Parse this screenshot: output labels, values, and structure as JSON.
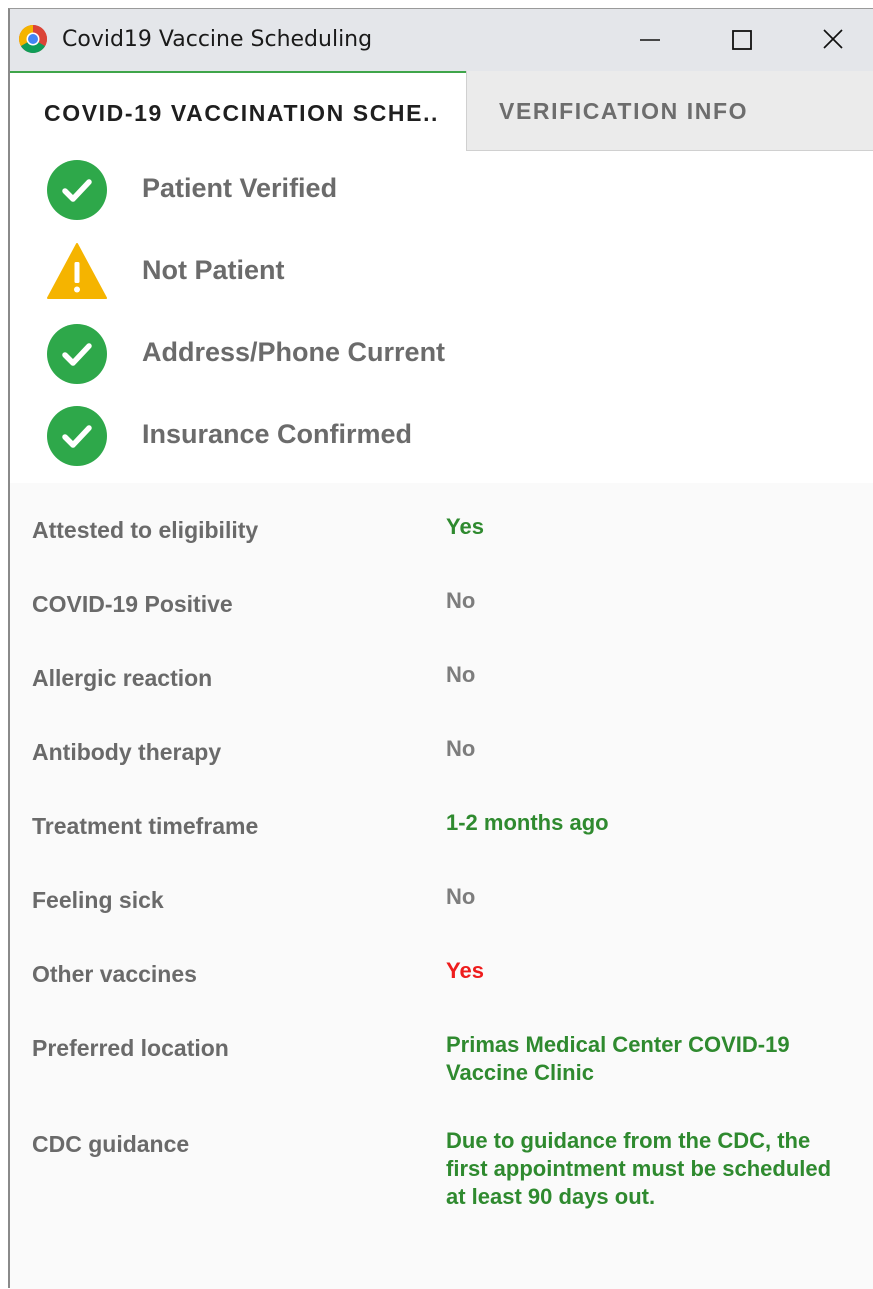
{
  "window": {
    "title": "Covid19 Vaccine Scheduling",
    "app_icon": "chrome-icon"
  },
  "tabs": [
    {
      "label": "COVID-19 VACCINATION SCHE..",
      "active": true
    },
    {
      "label": "VERIFICATION INFO",
      "active": false
    }
  ],
  "status_items": [
    {
      "label": "Patient Verified",
      "icon": "check-circle-icon",
      "status": "ok"
    },
    {
      "label": "Not Patient",
      "icon": "warning-icon",
      "status": "warning"
    },
    {
      "label": "Address/Phone Current",
      "icon": "check-circle-icon",
      "status": "ok"
    },
    {
      "label": "Insurance Confirmed",
      "icon": "check-circle-icon",
      "status": "ok"
    }
  ],
  "details": [
    {
      "label": "Attested to eligibility",
      "value": "Yes",
      "tone": "green"
    },
    {
      "label": "COVID-19 Positive",
      "value": "No",
      "tone": "gray"
    },
    {
      "label": "Allergic reaction",
      "value": "No",
      "tone": "gray"
    },
    {
      "label": "Antibody therapy",
      "value": "No",
      "tone": "gray"
    },
    {
      "label": "Treatment timeframe",
      "value": "1-2 months ago",
      "tone": "green"
    },
    {
      "label": "Feeling sick",
      "value": "No",
      "tone": "gray"
    },
    {
      "label": "Other vaccines",
      "value": "Yes",
      "tone": "red"
    },
    {
      "label": "Preferred location",
      "value": "Primas Medical Center COVID-19 Vaccine Clinic",
      "tone": "green"
    },
    {
      "label": "CDC guidance",
      "value": "Due to guidance from the CDC, the first appointment must be scheduled at least 90 days out.",
      "tone": "green"
    }
  ],
  "colors": {
    "ok": "#2ea84a",
    "warning": "#f5b400",
    "value_green": "#2f8a2f",
    "value_gray": "#7d7d7d",
    "value_red": "#ee1c1c",
    "active_tab_accent": "#3fa54a"
  }
}
